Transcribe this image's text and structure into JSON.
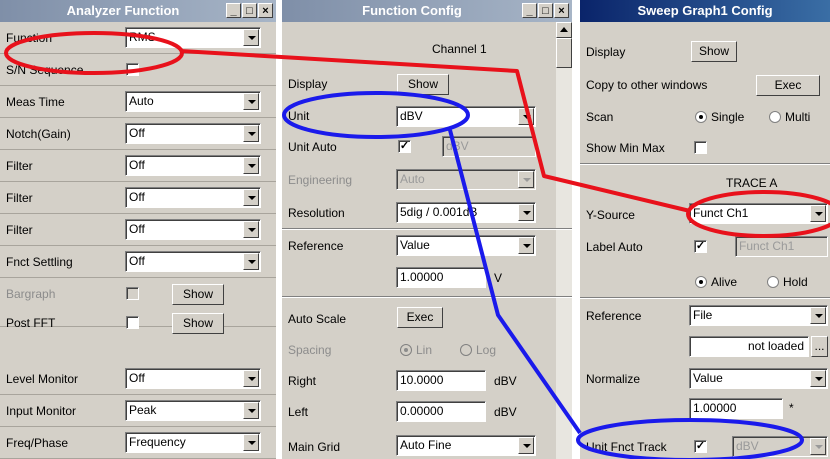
{
  "window_buttons": {
    "minimize": "_",
    "maximize": "□",
    "close": "×"
  },
  "analyzer": {
    "title": "Analyzer Function",
    "function_label": "Function",
    "function_value": "RMS",
    "sn_label": "S/N Sequence",
    "meas_time_label": "Meas Time",
    "meas_time_value": "Auto",
    "notch_label": "Notch(Gain)",
    "notch_value": "Off",
    "filter1_label": "Filter",
    "filter1_value": "Off",
    "filter2_label": "Filter",
    "filter2_value": "Off",
    "filter3_label": "Filter",
    "filter3_value": "Off",
    "settling_label": "Fnct Settling",
    "settling_value": "Off",
    "bargraph_label": "Bargraph",
    "bargraph_button": "Show",
    "postfft_label": "Post FFT",
    "postfft_button": "Show",
    "level_label": "Level Monitor",
    "level_value": "Off",
    "input_label": "Input Monitor",
    "input_value": "Peak",
    "freq_label": "Freq/Phase",
    "freq_value": "Frequency"
  },
  "function_config": {
    "title": "Function Config",
    "channel": "Channel 1",
    "display_label": "Display",
    "display_button": "Show",
    "unit_label": "Unit",
    "unit_value": "dBV",
    "unit_auto_label": "Unit Auto",
    "unit_auto_field": "dBV",
    "engineering_label": "Engineering",
    "engineering_value": "Auto",
    "resolution_label": "Resolution",
    "resolution_value": "5dig / 0.001dB",
    "reference_label": "Reference",
    "reference_value": "Value",
    "reference_number": "1.00000",
    "reference_unit": "V",
    "autoscale_label": "Auto Scale",
    "autoscale_button": "Exec",
    "spacing_label": "Spacing",
    "spacing_lin": "Lin",
    "spacing_log": "Log",
    "right_label": "Right",
    "right_value": "10.0000",
    "right_unit": "dBV",
    "left_label": "Left",
    "left_value": "0.00000",
    "left_unit": "dBV",
    "maingrid_label": "Main Grid",
    "maingrid_value": "Auto Fine"
  },
  "sweep_config": {
    "title": "Sweep Graph1 Config",
    "display_label": "Display",
    "display_button": "Show",
    "copy_label": "Copy to other windows",
    "copy_button": "Exec",
    "scan_label": "Scan",
    "scan_single": "Single",
    "scan_multi": "Multi",
    "minmax_label": "Show Min Max",
    "trace_header": "TRACE A",
    "ysource_label": "Y-Source",
    "ysource_value": "Funct Ch1",
    "labelauto_label": "Label Auto",
    "labelauto_field": "Funct Ch1",
    "alive": "Alive",
    "hold": "Hold",
    "reference_label": "Reference",
    "reference_value": "File",
    "not_loaded": "not loaded",
    "browse": "...",
    "normalize_label": "Normalize",
    "normalize_value": "Value",
    "normalize_number": "1.00000",
    "normalize_unit": "*",
    "unittrack_label": "Unit Fnct Track",
    "unittrack_value": "dBV"
  },
  "colors": {
    "highlight_red": "#e8111b",
    "highlight_blue": "#1a1aeb",
    "active_title": "#0a246a",
    "inactive_title": "#7f8fa8"
  }
}
